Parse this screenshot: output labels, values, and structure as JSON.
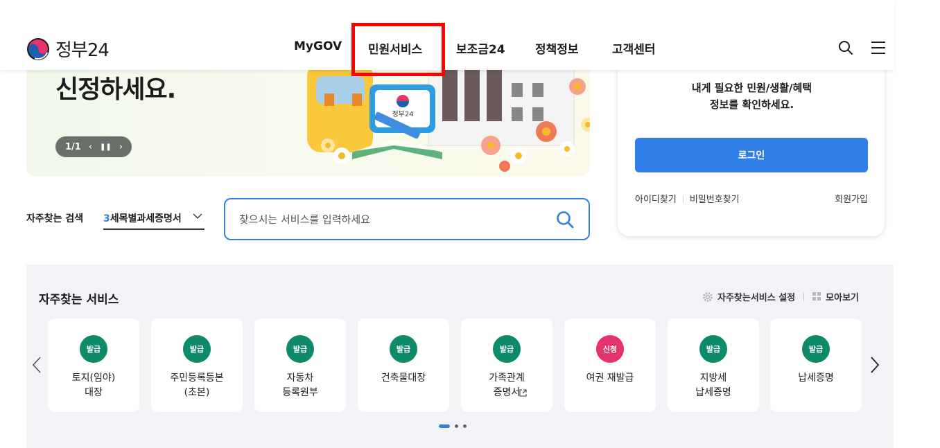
{
  "header": {
    "logo_text": "정부24",
    "nav": [
      {
        "label": "MyGOV"
      },
      {
        "label": "민원서비스"
      },
      {
        "label": "보조금24"
      },
      {
        "label": "정책정보"
      },
      {
        "label": "고객센터"
      }
    ],
    "icons": [
      "search-icon",
      "menu-icon"
    ]
  },
  "banner": {
    "title": "신정하세요.",
    "pager": "1/1",
    "illustration_label": "정부24"
  },
  "login": {
    "message_line1": "내게 필요한 민원/생활/혜택",
    "message_line2": "정보를 확인하세요.",
    "button_label": "로그인",
    "find_id": "아이디찾기",
    "find_password": "비밀번호찾기",
    "signup": "회원가입"
  },
  "search": {
    "fav_label": "자주찾는 검색",
    "fav_number": "3",
    "fav_value": "세목별과세증명서",
    "placeholder": "찾으시는 서비스를 입력하세요"
  },
  "services": {
    "title": "자주찾는 서비스",
    "settings_label": "자주찾는서비스 설정",
    "view_all_label": "모아보기",
    "items": [
      {
        "badge": "발급",
        "badge_color": "#0e8a6b",
        "name": "토지(임야)\n대장"
      },
      {
        "badge": "발급",
        "badge_color": "#0e8a6b",
        "name": "주민등록등본\n(초본)"
      },
      {
        "badge": "발급",
        "badge_color": "#0e8a6b",
        "name": "자동차\n등록원부"
      },
      {
        "badge": "발급",
        "badge_color": "#0e8a6b",
        "name": "건축물대장"
      },
      {
        "badge": "발급",
        "badge_color": "#0e8a6b",
        "name": "가족관계\n증명서"
      },
      {
        "badge": "신청",
        "badge_color": "#e5336b",
        "name": "여권 재발급"
      },
      {
        "badge": "발급",
        "badge_color": "#0e8a6b",
        "name": "지방세\n납세증명"
      },
      {
        "badge": "발급",
        "badge_color": "#0e8a6b",
        "name": "납세증명"
      }
    ]
  },
  "colors": {
    "accent_blue": "#2f7fe6",
    "highlight_red": "#ff0000",
    "issue_green": "#0e8a6b",
    "apply_pink": "#e5336b"
  }
}
